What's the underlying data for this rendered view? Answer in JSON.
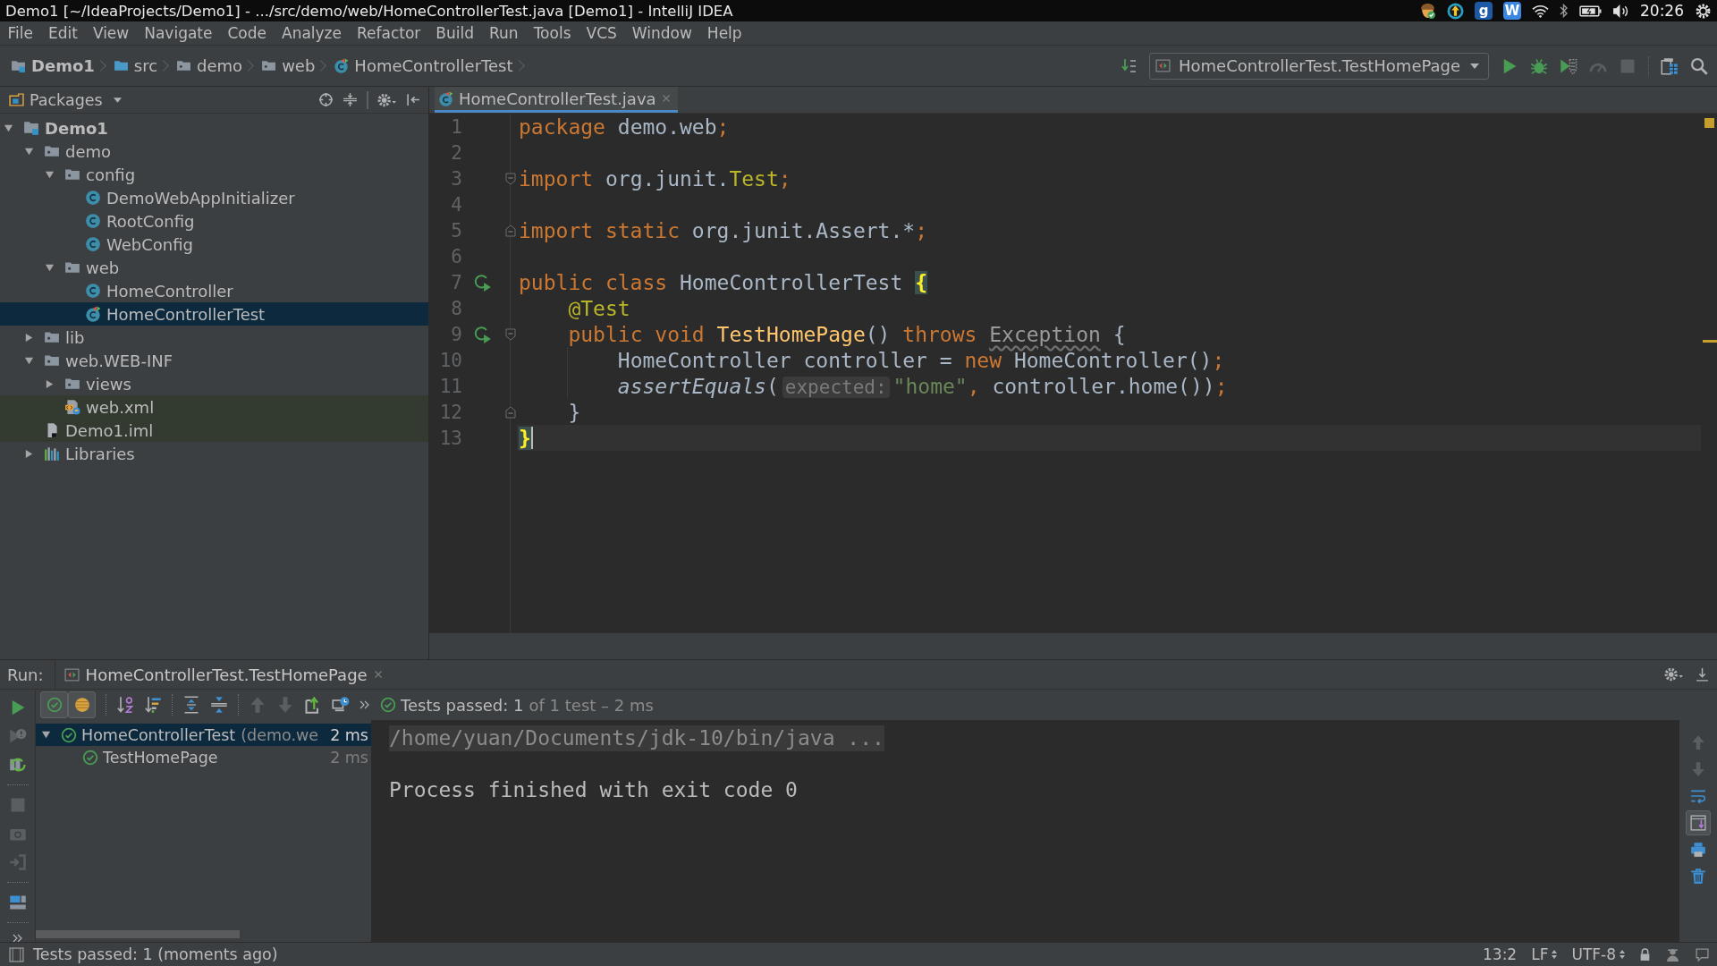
{
  "window": {
    "title": "Demo1 [~/IdeaProjects/Demo1] - .../src/demo/web/HomeControllerTest.java [Demo1] - IntelliJ IDEA"
  },
  "system_tray": {
    "items": [
      {
        "kind": "acorn"
      },
      {
        "kind": "update"
      },
      {
        "kind": "letter-tile",
        "label": "g",
        "color": "#1c5aa6"
      },
      {
        "kind": "letter-tile",
        "label": "W",
        "color": "#3a86e0"
      },
      {
        "kind": "wifi"
      },
      {
        "kind": "bluetooth"
      },
      {
        "kind": "battery"
      },
      {
        "kind": "volume"
      }
    ],
    "clock": "20:26"
  },
  "menu": [
    "File",
    "Edit",
    "View",
    "Navigate",
    "Code",
    "Analyze",
    "Refactor",
    "Build",
    "Run",
    "Tools",
    "VCS",
    "Window",
    "Help"
  ],
  "navigation_bar": {
    "breadcrumbs": [
      {
        "label": "Demo1",
        "kind": "project"
      },
      {
        "label": "src",
        "kind": "source-folder"
      },
      {
        "label": "demo",
        "kind": "package"
      },
      {
        "label": "web",
        "kind": "package"
      },
      {
        "label": "HomeControllerTest",
        "kind": "test-class"
      }
    ],
    "run_configuration": "HomeControllerTest.TestHomePage",
    "actions": [
      {
        "kind": "run",
        "disabled": false
      },
      {
        "kind": "debug",
        "disabled": false
      },
      {
        "kind": "coverage",
        "disabled": false
      },
      {
        "kind": "profile",
        "disabled": true
      },
      {
        "kind": "stop",
        "disabled": true
      },
      {
        "kind": "structure",
        "disabled": false
      },
      {
        "kind": "search",
        "disabled": false
      }
    ]
  },
  "project_panel": {
    "view": "Packages",
    "tree": [
      {
        "label": "Demo1",
        "kind": "project",
        "expanded": true,
        "selected": false,
        "highlighted": false,
        "children": [
          {
            "label": "demo",
            "kind": "package",
            "expanded": true,
            "selected": false,
            "highlighted": false,
            "children": [
              {
                "label": "config",
                "kind": "package",
                "expanded": true,
                "selected": false,
                "highlighted": false,
                "children": [
                  {
                    "label": "DemoWebAppInitializer",
                    "kind": "class",
                    "selected": false,
                    "highlighted": false
                  },
                  {
                    "label": "RootConfig",
                    "kind": "class",
                    "selected": false,
                    "highlighted": false
                  },
                  {
                    "label": "WebConfig",
                    "kind": "class",
                    "selected": false,
                    "highlighted": false
                  }
                ]
              },
              {
                "label": "web",
                "kind": "package",
                "expanded": true,
                "selected": false,
                "highlighted": false,
                "children": [
                  {
                    "label": "HomeController",
                    "kind": "class",
                    "selected": false,
                    "highlighted": false
                  },
                  {
                    "label": "HomeControllerTest",
                    "kind": "test-class",
                    "selected": true,
                    "highlighted": false
                  }
                ]
              }
            ]
          },
          {
            "label": "lib",
            "kind": "package",
            "expanded": false,
            "selected": false,
            "highlighted": false
          },
          {
            "label": "web.WEB-INF",
            "kind": "package",
            "expanded": true,
            "selected": false,
            "highlighted": false,
            "children": [
              {
                "label": "views",
                "kind": "package",
                "expanded": false,
                "selected": false,
                "highlighted": false
              },
              {
                "label": "web.xml",
                "kind": "xml",
                "selected": false,
                "highlighted": true
              }
            ]
          },
          {
            "label": "Demo1.iml",
            "kind": "module-file",
            "selected": false,
            "highlighted": true
          },
          {
            "label": "Libraries",
            "kind": "libraries",
            "expanded": false,
            "selected": false,
            "highlighted": false
          }
        ]
      }
    ]
  },
  "editor": {
    "tabs": [
      {
        "label": "HomeControllerTest.java",
        "selected": true
      }
    ],
    "lines": [
      {
        "number": "1",
        "kind": "code",
        "run_marker": false,
        "current": false,
        "tokens": [
          {
            "kind": "keyword",
            "text": "package"
          },
          {
            "kind": "plain",
            "text": " demo.web"
          },
          {
            "kind": "keyword",
            "text": ";"
          }
        ]
      },
      {
        "number": "2",
        "kind": "code",
        "run_marker": false,
        "current": false
      },
      {
        "number": "3",
        "kind": "fold-start",
        "run_marker": false,
        "current": false,
        "tokens": [
          {
            "kind": "keyword",
            "text": "import"
          },
          {
            "kind": "plain",
            "text": " org.junit."
          },
          {
            "kind": "annotation",
            "text": "Test"
          },
          {
            "kind": "keyword",
            "text": ";"
          }
        ]
      },
      {
        "number": "4",
        "kind": "code",
        "run_marker": false,
        "current": false
      },
      {
        "number": "5",
        "kind": "fold-end",
        "run_marker": false,
        "current": false,
        "tokens": [
          {
            "kind": "keyword",
            "text": "import static"
          },
          {
            "kind": "plain",
            "text": " org.junit.Assert.*"
          },
          {
            "kind": "keyword",
            "text": ";"
          }
        ]
      },
      {
        "number": "6",
        "kind": "code",
        "run_marker": false,
        "current": false
      },
      {
        "number": "7",
        "kind": "code",
        "run_marker": true,
        "current": false,
        "tokens": [
          {
            "kind": "keyword",
            "text": "public class"
          },
          {
            "kind": "plain",
            "text": " HomeControllerTest "
          },
          {
            "kind": "brace-match",
            "text": "{"
          }
        ]
      },
      {
        "number": "8",
        "kind": "code",
        "run_marker": false,
        "current": false,
        "tokens": [
          {
            "kind": "annotation",
            "text": "    @Test"
          }
        ]
      },
      {
        "number": "9",
        "kind": "fold-start",
        "run_marker": true,
        "current": false,
        "tokens": [
          {
            "kind": "keyword",
            "text": "    public void "
          },
          {
            "kind": "method",
            "text": "TestHomePage"
          },
          {
            "kind": "plain",
            "text": "() "
          },
          {
            "kind": "keyword",
            "text": "throws "
          },
          {
            "kind": "warning",
            "text": "Exception"
          },
          {
            "kind": "plain",
            "text": " {"
          }
        ]
      },
      {
        "number": "10",
        "kind": "code",
        "run_marker": false,
        "current": false,
        "tokens": [
          {
            "kind": "plain",
            "text": "        HomeController controller = "
          },
          {
            "kind": "keyword",
            "text": "new"
          },
          {
            "kind": "plain",
            "text": " HomeController()"
          },
          {
            "kind": "keyword",
            "text": ";"
          }
        ]
      },
      {
        "number": "11",
        "kind": "code",
        "run_marker": false,
        "current": false,
        "tokens": [
          {
            "kind": "static-call",
            "text": "        assertEquals"
          },
          {
            "kind": "plain",
            "text": "("
          },
          {
            "kind": "hint",
            "text": "expected:"
          },
          {
            "kind": "string",
            "text": "\"home\""
          },
          {
            "kind": "keyword",
            "text": ","
          },
          {
            "kind": "plain",
            "text": " controller.home())"
          },
          {
            "kind": "keyword",
            "text": ";"
          }
        ]
      },
      {
        "number": "12",
        "kind": "fold-end",
        "run_marker": false,
        "current": false,
        "tokens": [
          {
            "kind": "plain",
            "text": "    }"
          }
        ]
      },
      {
        "number": "13",
        "kind": "code",
        "run_marker": false,
        "current": true,
        "tokens": [
          {
            "kind": "brace-match",
            "text": "}"
          }
        ]
      }
    ]
  },
  "run_panel": {
    "label": "Run:",
    "tabs": [
      {
        "label": "HomeControllerTest.TestHomePage",
        "selected": true
      }
    ],
    "filters": [
      {
        "kind": "passed",
        "selected": true
      },
      {
        "kind": "ignored",
        "selected": true
      }
    ],
    "summary": "Tests passed: 1",
    "summary_detail": "of 1 test – 2 ms",
    "tests": [
      {
        "label": "HomeControllerTest",
        "detail": "(demo.we",
        "time": "2 ms",
        "kind": "passed",
        "selected": true,
        "expanded": true,
        "children": [
          {
            "label": "TestHomePage",
            "time": "2 ms",
            "kind": "passed",
            "selected": false
          }
        ]
      }
    ],
    "console": [
      {
        "kind": "command",
        "text": "/home/yuan/Documents/jdk-10/bin/java ..."
      },
      {
        "kind": "system",
        "text": "Process finished with exit code 0"
      }
    ],
    "console_toggles": [
      {
        "kind": "soft-wrap",
        "selected": false
      },
      {
        "kind": "scroll-to-end",
        "selected": true
      }
    ]
  },
  "status_bar": {
    "message": "Tests passed: 1 (moments ago)",
    "position": "13:2",
    "line_separator": "LF",
    "encoding": "UTF-8"
  }
}
